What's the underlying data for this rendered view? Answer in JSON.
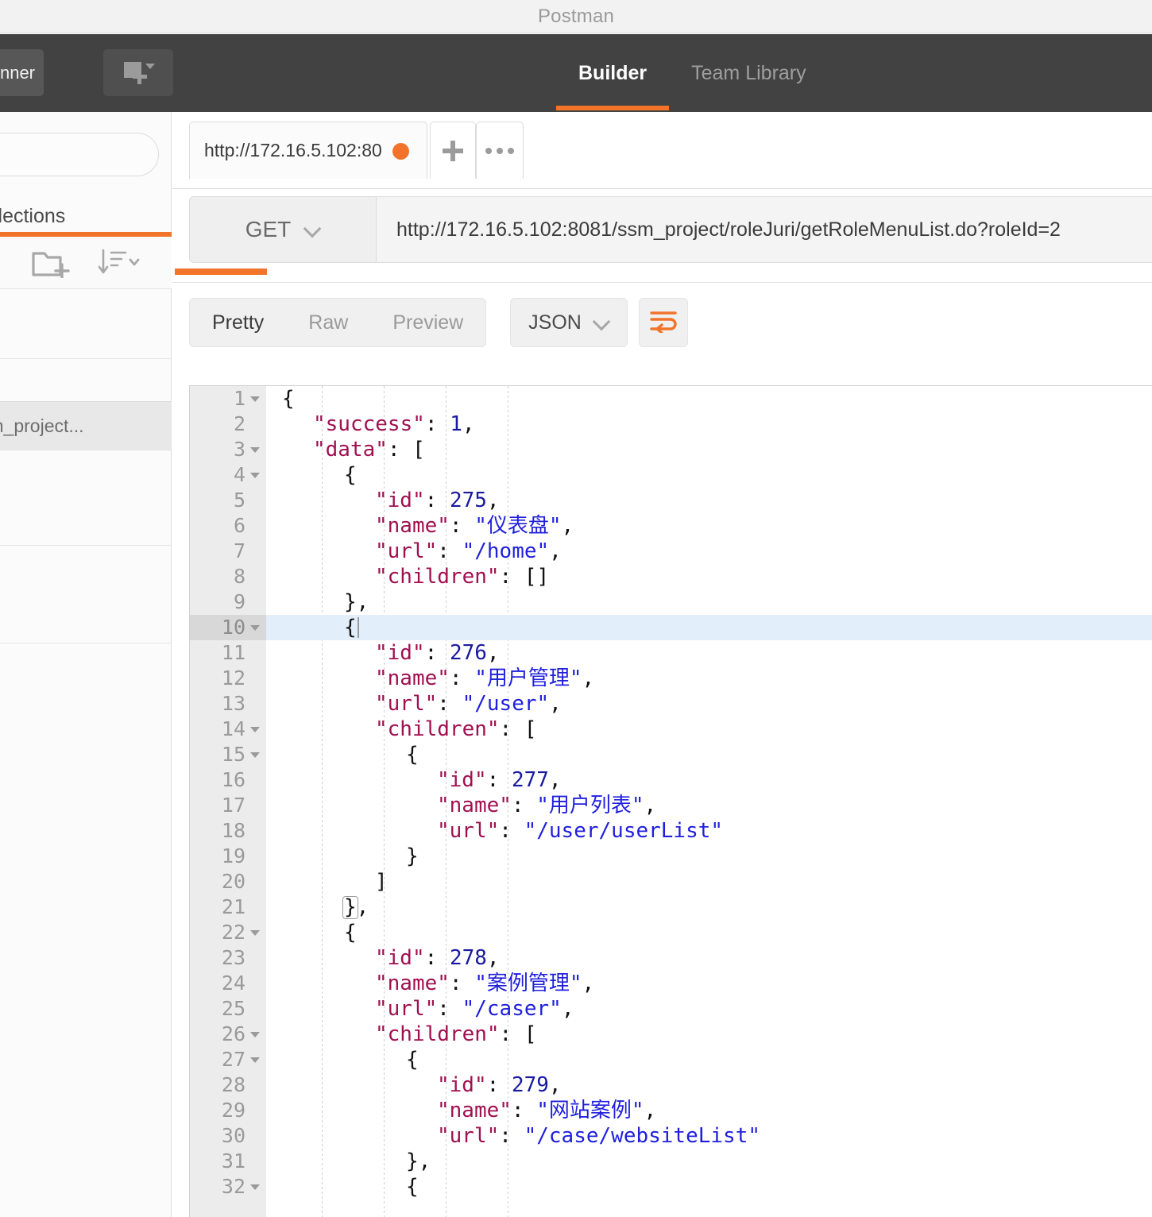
{
  "window": {
    "title": "Postman"
  },
  "header": {
    "runner_label": "Runner",
    "new_window_icon": "new-window-icon",
    "tabs": [
      {
        "label": "Builder",
        "active": true
      },
      {
        "label": "Team Library",
        "active": false
      }
    ],
    "accent_color": "#f1742a",
    "background_color": "#424242"
  },
  "sidebar": {
    "search_placeholder": "",
    "tab_label": "Collections",
    "new_folder_icon": "new-folder-icon",
    "sort_icon": "sort-descending-icon",
    "items": [
      {
        "label": "",
        "selected": false
      },
      {
        "label": "/ssm_project...",
        "selected": true
      },
      {
        "label": "",
        "selected": false
      },
      {
        "label": "",
        "selected": false
      }
    ]
  },
  "request": {
    "tab_label": "http://172.16.5.102:80",
    "tab_unsaved_dot_color": "#f1742a",
    "add_tab_label": "+",
    "more_tabs_icon": "ellipsis-icon",
    "method": "GET",
    "url": "http://172.16.5.102:8081/ssm_project/roleJuri/getRoleMenuList.do?roleId=2"
  },
  "response": {
    "view_tabs": [
      {
        "label": "Pretty",
        "active": true
      },
      {
        "label": "Raw",
        "active": false
      },
      {
        "label": "Preview",
        "active": false
      }
    ],
    "format": "JSON",
    "wrap_lines_icon": "wrap-lines-icon",
    "active_line": 10,
    "lines": [
      {
        "num": 1,
        "fold": true,
        "indent": 0,
        "tokens": [
          {
            "t": "p",
            "v": "{"
          }
        ]
      },
      {
        "num": 2,
        "fold": false,
        "indent": 1,
        "tokens": [
          {
            "t": "k",
            "v": "\"success\""
          },
          {
            "t": "p",
            "v": ": "
          },
          {
            "t": "n",
            "v": "1"
          },
          {
            "t": "p",
            "v": ","
          }
        ]
      },
      {
        "num": 3,
        "fold": true,
        "indent": 1,
        "tokens": [
          {
            "t": "k",
            "v": "\"data\""
          },
          {
            "t": "p",
            "v": ": ["
          }
        ]
      },
      {
        "num": 4,
        "fold": true,
        "indent": 2,
        "tokens": [
          {
            "t": "p",
            "v": "{"
          }
        ]
      },
      {
        "num": 5,
        "fold": false,
        "indent": 3,
        "tokens": [
          {
            "t": "k",
            "v": "\"id\""
          },
          {
            "t": "p",
            "v": ": "
          },
          {
            "t": "n",
            "v": "275"
          },
          {
            "t": "p",
            "v": ","
          }
        ]
      },
      {
        "num": 6,
        "fold": false,
        "indent": 3,
        "tokens": [
          {
            "t": "k",
            "v": "\"name\""
          },
          {
            "t": "p",
            "v": ": "
          },
          {
            "t": "s",
            "v": "\"仪表盘\""
          },
          {
            "t": "p",
            "v": ","
          }
        ]
      },
      {
        "num": 7,
        "fold": false,
        "indent": 3,
        "tokens": [
          {
            "t": "k",
            "v": "\"url\""
          },
          {
            "t": "p",
            "v": ": "
          },
          {
            "t": "s",
            "v": "\"/home\""
          },
          {
            "t": "p",
            "v": ","
          }
        ]
      },
      {
        "num": 8,
        "fold": false,
        "indent": 3,
        "tokens": [
          {
            "t": "k",
            "v": "\"children\""
          },
          {
            "t": "p",
            "v": ": []"
          }
        ]
      },
      {
        "num": 9,
        "fold": false,
        "indent": 2,
        "tokens": [
          {
            "t": "p",
            "v": "},"
          }
        ]
      },
      {
        "num": 10,
        "fold": true,
        "indent": 2,
        "tokens": [
          {
            "t": "p",
            "v": "{"
          }
        ],
        "cursor": true,
        "active": true
      },
      {
        "num": 11,
        "fold": false,
        "indent": 3,
        "tokens": [
          {
            "t": "k",
            "v": "\"id\""
          },
          {
            "t": "p",
            "v": ": "
          },
          {
            "t": "n",
            "v": "276"
          },
          {
            "t": "p",
            "v": ","
          }
        ]
      },
      {
        "num": 12,
        "fold": false,
        "indent": 3,
        "tokens": [
          {
            "t": "k",
            "v": "\"name\""
          },
          {
            "t": "p",
            "v": ": "
          },
          {
            "t": "s",
            "v": "\"用户管理\""
          },
          {
            "t": "p",
            "v": ","
          }
        ]
      },
      {
        "num": 13,
        "fold": false,
        "indent": 3,
        "tokens": [
          {
            "t": "k",
            "v": "\"url\""
          },
          {
            "t": "p",
            "v": ": "
          },
          {
            "t": "s",
            "v": "\"/user\""
          },
          {
            "t": "p",
            "v": ","
          }
        ]
      },
      {
        "num": 14,
        "fold": true,
        "indent": 3,
        "tokens": [
          {
            "t": "k",
            "v": "\"children\""
          },
          {
            "t": "p",
            "v": ": ["
          }
        ]
      },
      {
        "num": 15,
        "fold": true,
        "indent": 4,
        "tokens": [
          {
            "t": "p",
            "v": "{"
          }
        ]
      },
      {
        "num": 16,
        "fold": false,
        "indent": 5,
        "tokens": [
          {
            "t": "k",
            "v": "\"id\""
          },
          {
            "t": "p",
            "v": ": "
          },
          {
            "t": "n",
            "v": "277"
          },
          {
            "t": "p",
            "v": ","
          }
        ]
      },
      {
        "num": 17,
        "fold": false,
        "indent": 5,
        "tokens": [
          {
            "t": "k",
            "v": "\"name\""
          },
          {
            "t": "p",
            "v": ": "
          },
          {
            "t": "s",
            "v": "\"用户列表\""
          },
          {
            "t": "p",
            "v": ","
          }
        ]
      },
      {
        "num": 18,
        "fold": false,
        "indent": 5,
        "tokens": [
          {
            "t": "k",
            "v": "\"url\""
          },
          {
            "t": "p",
            "v": ": "
          },
          {
            "t": "s",
            "v": "\"/user/userList\""
          }
        ]
      },
      {
        "num": 19,
        "fold": false,
        "indent": 4,
        "tokens": [
          {
            "t": "p",
            "v": "}"
          }
        ]
      },
      {
        "num": 20,
        "fold": false,
        "indent": 3,
        "tokens": [
          {
            "t": "p",
            "v": "]"
          }
        ]
      },
      {
        "num": 21,
        "fold": false,
        "indent": 2,
        "tokens": [
          {
            "t": "p",
            "v": "}",
            "box": true
          },
          {
            "t": "p",
            "v": ","
          }
        ]
      },
      {
        "num": 22,
        "fold": true,
        "indent": 2,
        "tokens": [
          {
            "t": "p",
            "v": "{"
          }
        ]
      },
      {
        "num": 23,
        "fold": false,
        "indent": 3,
        "tokens": [
          {
            "t": "k",
            "v": "\"id\""
          },
          {
            "t": "p",
            "v": ": "
          },
          {
            "t": "n",
            "v": "278"
          },
          {
            "t": "p",
            "v": ","
          }
        ]
      },
      {
        "num": 24,
        "fold": false,
        "indent": 3,
        "tokens": [
          {
            "t": "k",
            "v": "\"name\""
          },
          {
            "t": "p",
            "v": ": "
          },
          {
            "t": "s",
            "v": "\"案例管理\""
          },
          {
            "t": "p",
            "v": ","
          }
        ]
      },
      {
        "num": 25,
        "fold": false,
        "indent": 3,
        "tokens": [
          {
            "t": "k",
            "v": "\"url\""
          },
          {
            "t": "p",
            "v": ": "
          },
          {
            "t": "s",
            "v": "\"/caser\""
          },
          {
            "t": "p",
            "v": ","
          }
        ]
      },
      {
        "num": 26,
        "fold": true,
        "indent": 3,
        "tokens": [
          {
            "t": "k",
            "v": "\"children\""
          },
          {
            "t": "p",
            "v": ": ["
          }
        ]
      },
      {
        "num": 27,
        "fold": true,
        "indent": 4,
        "tokens": [
          {
            "t": "p",
            "v": "{"
          }
        ]
      },
      {
        "num": 28,
        "fold": false,
        "indent": 5,
        "tokens": [
          {
            "t": "k",
            "v": "\"id\""
          },
          {
            "t": "p",
            "v": ": "
          },
          {
            "t": "n",
            "v": "279"
          },
          {
            "t": "p",
            "v": ","
          }
        ]
      },
      {
        "num": 29,
        "fold": false,
        "indent": 5,
        "tokens": [
          {
            "t": "k",
            "v": "\"name\""
          },
          {
            "t": "p",
            "v": ": "
          },
          {
            "t": "s",
            "v": "\"网站案例\""
          },
          {
            "t": "p",
            "v": ","
          }
        ]
      },
      {
        "num": 30,
        "fold": false,
        "indent": 5,
        "tokens": [
          {
            "t": "k",
            "v": "\"url\""
          },
          {
            "t": "p",
            "v": ": "
          },
          {
            "t": "s",
            "v": "\"/case/websiteList\""
          }
        ]
      },
      {
        "num": 31,
        "fold": false,
        "indent": 4,
        "tokens": [
          {
            "t": "p",
            "v": "},"
          }
        ]
      },
      {
        "num": 32,
        "fold": true,
        "indent": 4,
        "tokens": [
          {
            "t": "p",
            "v": "{"
          }
        ]
      }
    ]
  },
  "colors": {
    "accent": "#f1742a",
    "key": "#a01050",
    "string": "#1f1fdd",
    "number": "#1a1a9e",
    "active_line": "#e3eefb"
  }
}
